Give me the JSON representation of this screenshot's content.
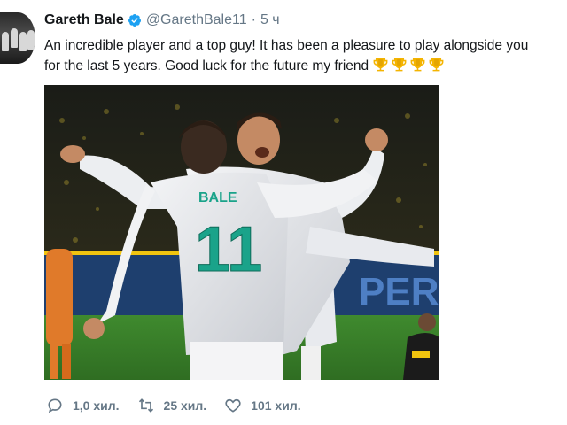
{
  "tweet": {
    "author_name": "Gareth Bale",
    "handle": "@GarethBale11",
    "separator": "·",
    "time": "5 ч",
    "text_line1": "An incredible player and a top guy! It has been a pleasure to play alongside you",
    "text_line2": "for the last 5 years. Good luck for the future my friend",
    "emoji": [
      "trophy-icon",
      "trophy-icon",
      "trophy-icon",
      "trophy-icon"
    ]
  },
  "photo": {
    "jersey_name": "BALE",
    "jersey_number": "11",
    "board_text": "PER"
  },
  "actions": {
    "replies": "1,0 хил.",
    "retweets": "25 хил.",
    "likes": "101 хил."
  },
  "colors": {
    "verified": "#1da1f2",
    "muted": "#657786",
    "jersey_number": "#1aa38a"
  }
}
